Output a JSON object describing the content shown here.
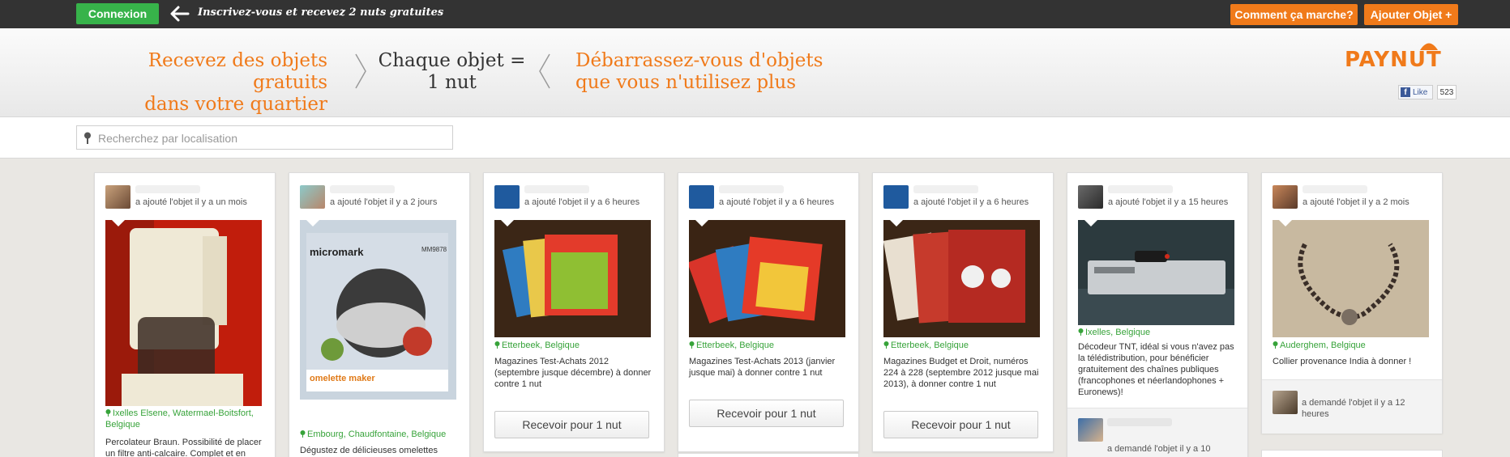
{
  "topbar": {
    "login_label": "Connexion",
    "promo_text": "Inscrivez-vous et recevez 2 nuts gratuites",
    "how_label": "Comment ça marche?",
    "add_label": "Ajouter Objet +"
  },
  "hero": {
    "left_line1": "Recevez des objets gratuits",
    "left_line2": "dans votre quartier",
    "mid_line1": "Chaque objet =",
    "mid_line2": "1 nut",
    "right_line1": "Débarrassez-vous d'objets",
    "right_line2": "que vous n'utilisez plus",
    "logo": "PAYNUT",
    "like_label": "Like",
    "like_count": "523"
  },
  "search": {
    "placeholder": "Recherchez par localisation"
  },
  "colors": {
    "accent_orange": "#f07a1a",
    "accent_green": "#37b34a",
    "topbar": "#333333"
  },
  "cards": [
    {
      "meta": "a ajouté l'objet il y a un mois",
      "location": "Ixelles Elsene, Watermael-Boitsfort, Belgique",
      "description": "Percolateur Braun. Possibilité de placer un filtre anti-calcaire. Complet et en"
    },
    {
      "meta": "a ajouté l'objet il y a 2 jours",
      "photo_brand": "micromark",
      "photo_model": "MM9878",
      "photo_product": "omelette maker",
      "location": "Embourg, Chaudfontaine, Belgique",
      "description": "Dégustez de délicieuses omelettes"
    },
    {
      "meta": "a ajouté l'objet il y a 6 heures",
      "location": "Etterbeek, Belgique",
      "description": "Magazines Test-Achats 2012 (septembre jusque décembre) à donner contre 1 nut",
      "button": "Recevoir pour 1 nut"
    },
    {
      "meta": "a ajouté l'objet il y a 6 heures",
      "location": "Etterbeek, Belgique",
      "description": "Magazines Test-Achats 2013 (janvier jusque mai) à donner contre 1 nut",
      "button": "Recevoir pour 1 nut"
    },
    {
      "meta": "a ajouté l'objet il y a 6 heures",
      "location": "Etterbeek, Belgique",
      "description": "Magazines Budget et Droit, numéros 224 à 228 (septembre 2012 jusque mai 2013), à donner contre 1 nut",
      "button": "Recevoir pour 1 nut"
    },
    {
      "meta": "a ajouté l'objet il y a 15 heures",
      "location": "Ixelles, Belgique",
      "description": "Décodeur TNT, idéal si vous n'avez pas la télédistribution, pour bénéficier gratuitement des chaînes publiques (francophones et néerlandophones + Euronews)!",
      "request": "a demandé l'objet il y a 10"
    },
    {
      "meta": "a ajouté l'objet il y a 2 mois",
      "location": "Auderghem, Belgique",
      "description": "Collier provenance India à donner !",
      "request": "a demandé l'objet il y a 12 heures"
    }
  ]
}
